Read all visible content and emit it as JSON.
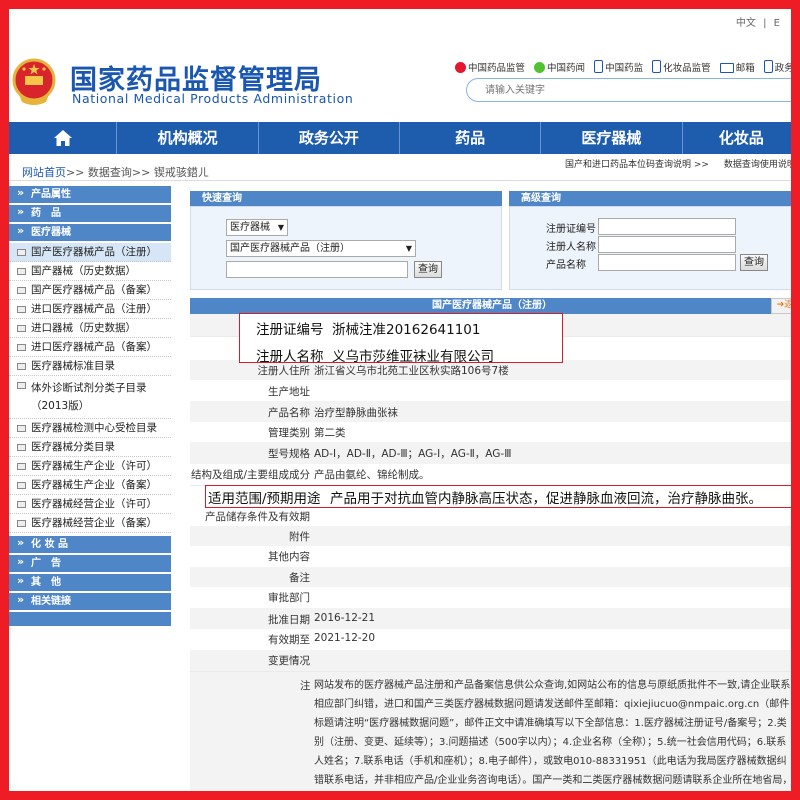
{
  "header": {
    "lang": [
      "中文",
      "|",
      "E"
    ],
    "site_name_cn": "国家药品监督管理局",
    "site_name_en": "National Medical Products Administration",
    "links": [
      {
        "label": "中国药品监管",
        "icon": "weibo-icon",
        "color": "#e6162d"
      },
      {
        "label": "中国药闻",
        "icon": "wechat-icon",
        "color": "#51c332"
      },
      {
        "label": "中国药监",
        "icon": "mobile-icon",
        "color": "#1a57b0"
      },
      {
        "label": "化妆品监管",
        "icon": "mobile-icon",
        "color": "#1a57b0"
      },
      {
        "label": "邮箱",
        "icon": "mail-icon",
        "color": "#1a57b0"
      },
      {
        "label": "政务公",
        "icon": "phone-icon",
        "color": "#1a57b0"
      }
    ],
    "search_placeholder": "请输入关键字"
  },
  "nav": {
    "home_icon": "home-icon",
    "items": [
      "机构概况",
      "政务公开",
      "药品",
      "医疗器械",
      "化妆品"
    ]
  },
  "breadcrumb": {
    "home": "网站首页",
    "rest": ">> 数据查询>> 锲戒骇鍣ㄦ"
  },
  "help_links": [
    "国产和进口药品本位码查询说明 >>",
    "数据查询使用说明"
  ],
  "sidebar": {
    "sections": [
      {
        "title": "产品属性",
        "items": []
      },
      {
        "title": "药　品",
        "items": []
      },
      {
        "title": "医疗器械",
        "items": [
          "国产医疗器械产品（注册）",
          "国产器械（历史数据）",
          "国产医疗器械产品（备案）",
          "进口医疗器械产品（注册）",
          "进口器械（历史数据）",
          "进口医疗器械产品（备案）",
          "医疗器械标准目录",
          "体外诊断试剂分类子目录（2013版）",
          "医疗器械检测中心受检目录",
          "医疗器械分类目录",
          "医疗器械生产企业（许可）",
          "医疗器械生产企业（备案）",
          "医疗器械经营企业（许可）",
          "医疗器械经营企业（备案）"
        ]
      },
      {
        "title": "化 妆 品",
        "items": []
      },
      {
        "title": "广　告",
        "items": []
      },
      {
        "title": "其　他",
        "items": []
      },
      {
        "title": "相关链接",
        "items": []
      }
    ],
    "active_index": 0
  },
  "quick_query": {
    "title": "快速查询",
    "category": "医疗器械",
    "database": "国产医疗器械产品（注册）",
    "button": "查询"
  },
  "advanced_query": {
    "title": "高级查询",
    "fields": [
      "注册证编号",
      "注册人名称",
      "产品名称"
    ],
    "button": "查询"
  },
  "detail": {
    "title": "国产医疗器械产品（注册）",
    "back": "返",
    "reg_no_label": "注册证编号",
    "reg_no": "浙械注准20162641101",
    "registrant_label": "注册人名称",
    "registrant": "义乌市莎维亚袜业有限公司",
    "rows": [
      {
        "k": "注册人住所",
        "v": "浙江省义乌市北苑工业区秋实路106号7楼"
      },
      {
        "k": "生产地址",
        "v": ""
      },
      {
        "k": "产品名称",
        "v": "治疗型静脉曲张袜"
      },
      {
        "k": "管理类别",
        "v": "第二类"
      },
      {
        "k": "型号规格",
        "v": "AD-Ⅰ，AD-Ⅱ，AD-Ⅲ；AG-Ⅰ，AG-Ⅱ，AG-Ⅲ"
      },
      {
        "k": "结构及组成/主要组成成分",
        "v": "产品由氨纶、锦纶制成。"
      }
    ],
    "purpose_label": "适用范围/预期用途",
    "purpose": "产品用于对抗血管内静脉高压状态，促进静脉血液回流，治疗静脉曲张。",
    "rows2": [
      {
        "k": "产品储存条件及有效期",
        "v": ""
      },
      {
        "k": "附件",
        "v": ""
      },
      {
        "k": "其他内容",
        "v": ""
      },
      {
        "k": "备注",
        "v": ""
      },
      {
        "k": "审批部门",
        "v": ""
      },
      {
        "k": "批准日期",
        "v": "2016-12-21"
      },
      {
        "k": "有效期至",
        "v": "2021-12-20"
      },
      {
        "k": "变更情况",
        "v": ""
      }
    ],
    "note_label": "注",
    "note": "网站发布的医疗器械产品注册和产品备案信息供公众查询,如网站公布的信息与原纸质批件不一致,请企业联系相应部门纠错，进口和国产三类医疗器械数据问题请发送邮件至邮箱：qixiejiucuo@nmpaic.org.cn（邮件标题请注明“医疗器械数据问题”，邮件正文中请准确填写以下全部信息：1.医疗器械注册证号/备案号；2.类别（注册、变更、延续等）；3.问题描述（500字以内）；4.企业名称（全称）；5.统一社会信用代码；6.联系人姓名；7.联系电话（手机和座机）；8.电子邮件），或致电010-88331951（此电话为我局医疗器械数据纠错联系电话，并非相应产品/企业业务咨询电话）。国产一类和二类医疗器械数据问题请联系企业所在地省局，由省局通过数据共享平台进行纠错和维护。"
  }
}
